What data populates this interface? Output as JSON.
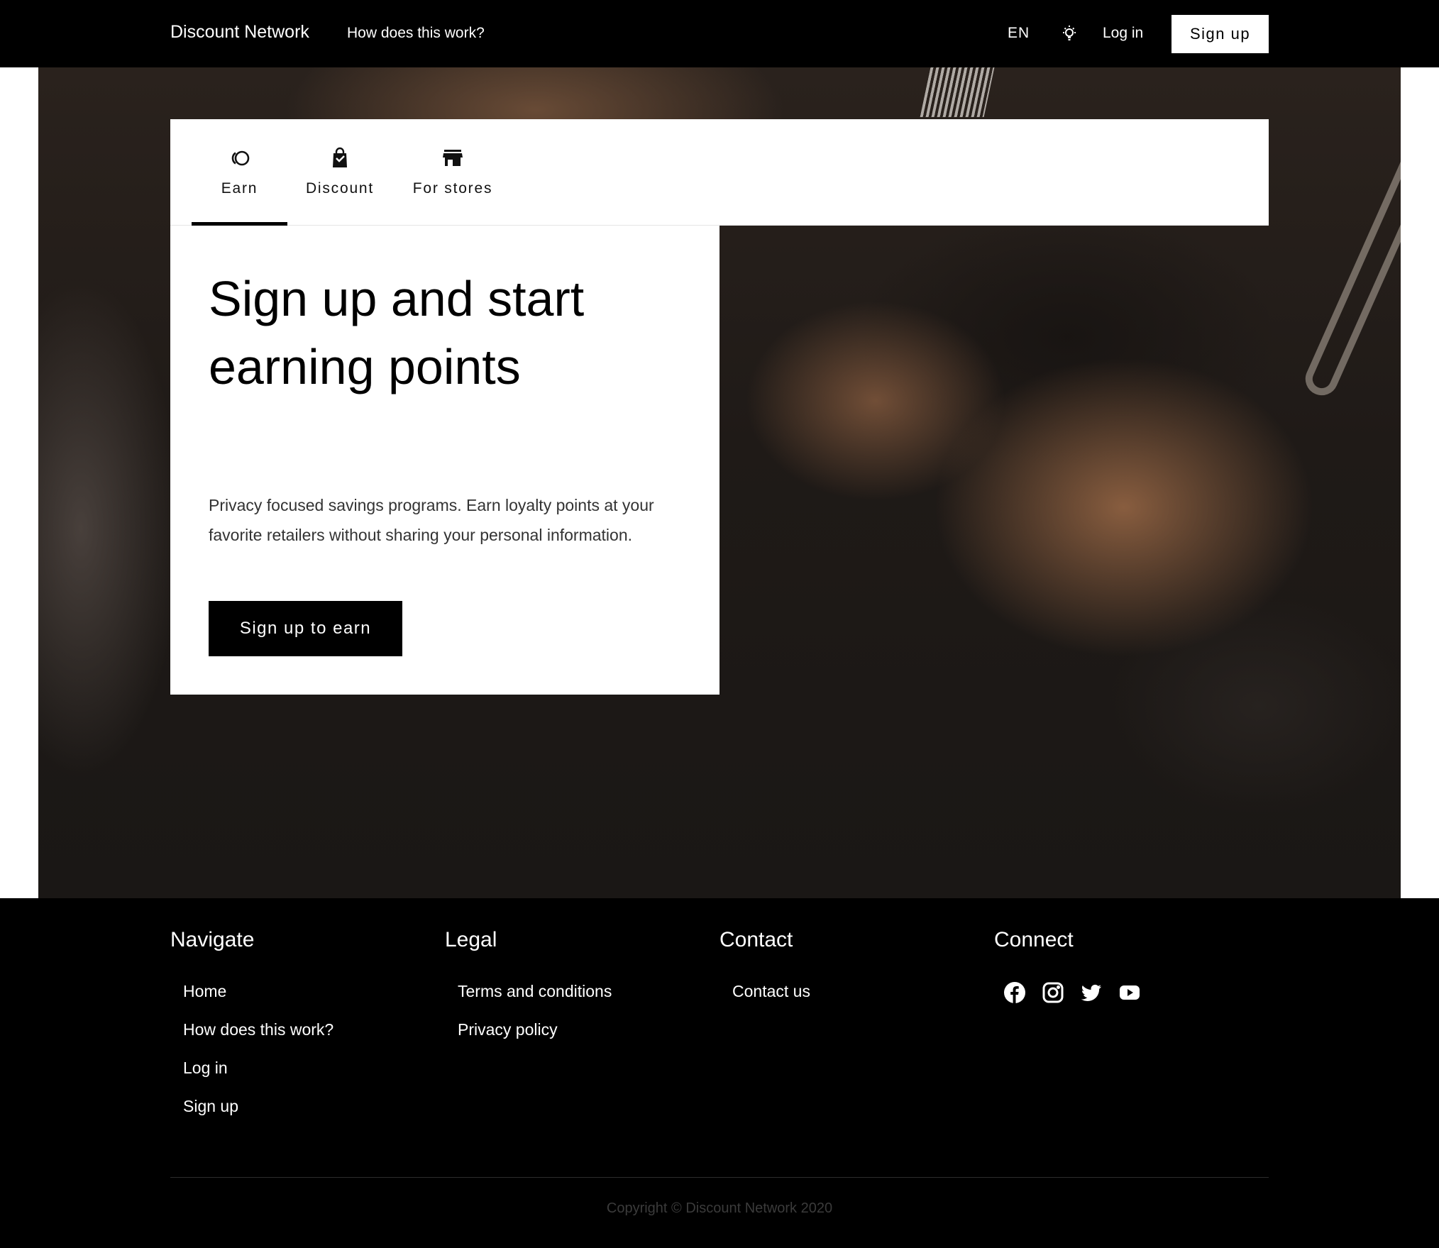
{
  "header": {
    "brand": "Discount Network",
    "how_link": "How does this work?",
    "language": "EN",
    "theme_icon": "lightbulb-icon",
    "login": "Log in",
    "signup": "Sign up"
  },
  "tabs": [
    {
      "label": "Earn",
      "icon": "coins-icon",
      "active": true
    },
    {
      "label": "Discount",
      "icon": "shopping-bag-icon",
      "active": false
    },
    {
      "label": "For stores",
      "icon": "storefront-icon",
      "active": false
    }
  ],
  "hero": {
    "headline": "Sign up and start earning points",
    "description": "Privacy focused savings programs. Earn loyalty points at your favorite retailers without sharing your personal information.",
    "cta": "Sign up to earn"
  },
  "footer": {
    "navigate": {
      "title": "Navigate",
      "links": [
        "Home",
        "How does this work?",
        "Log in",
        "Sign up"
      ]
    },
    "legal": {
      "title": "Legal",
      "links": [
        "Terms and conditions",
        "Privacy policy"
      ]
    },
    "contact": {
      "title": "Contact",
      "links": [
        "Contact us"
      ]
    },
    "connect": {
      "title": "Connect",
      "icons": [
        "facebook-icon",
        "instagram-icon",
        "twitter-icon",
        "youtube-icon"
      ]
    },
    "copyright": "Copyright © Discount Network 2020"
  },
  "colors": {
    "background": "#ffffff",
    "header": "#000000",
    "footer": "#000000",
    "accent": "#000000"
  }
}
